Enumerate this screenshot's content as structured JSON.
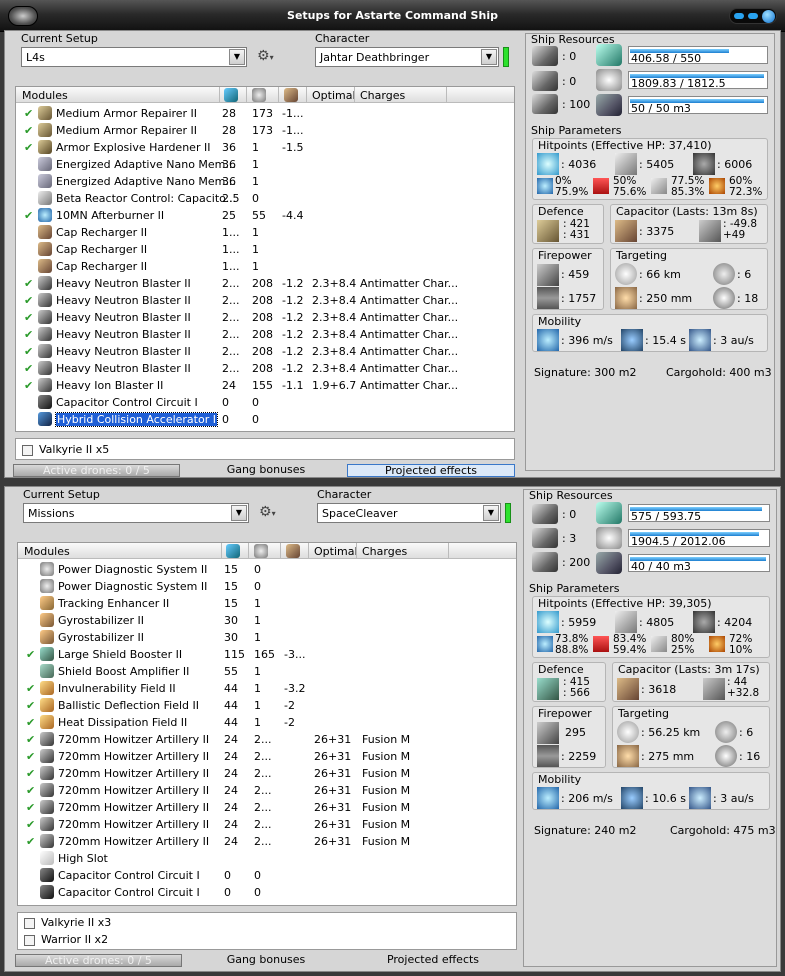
{
  "window": {
    "title": "Setups for Astarte Command Ship"
  },
  "colors": {
    "accent": "#1f5fd6",
    "ok": "#2de12d",
    "check": "#2a9a2a"
  },
  "labels": {
    "current_setup": "Current Setup",
    "character": "Character",
    "modules": "Modules",
    "optimal": "Optimal",
    "charges": "Charges",
    "ship_resources": "Ship Resources",
    "ship_parameters": "Ship Parameters",
    "defence": "Defence",
    "firepower": "Firepower",
    "targeting": "Targeting",
    "mobility": "Mobility",
    "gang_bonuses": "Gang bonuses",
    "projected_effects": "Projected effects",
    "active_drones": "Active drones: 0 / 5"
  },
  "setup1": {
    "setup_name": "L4s",
    "character": "Jahtar Deathbringer",
    "modules": [
      {
        "checked": true,
        "icon": "armor-repairer-icon",
        "name": "Medium Armor Repairer II",
        "cpu": "28",
        "pg": "173",
        "cap": "-1...",
        "optimal": "",
        "charges": ""
      },
      {
        "checked": true,
        "icon": "armor-repairer-icon",
        "name": "Medium Armor Repairer II",
        "cpu": "28",
        "pg": "173",
        "cap": "-1...",
        "optimal": "",
        "charges": ""
      },
      {
        "checked": true,
        "icon": "hardener-icon",
        "name": "Armor Explosive Hardener II",
        "cpu": "36",
        "pg": "1",
        "cap": "-1.5",
        "optimal": "",
        "charges": ""
      },
      {
        "checked": false,
        "icon": "nano-membrane-icon",
        "name": "Energized Adaptive Nano Mem...",
        "cpu": "36",
        "pg": "1",
        "cap": "",
        "optimal": "",
        "charges": ""
      },
      {
        "checked": false,
        "icon": "nano-membrane-icon",
        "name": "Energized Adaptive Nano Mem...",
        "cpu": "36",
        "pg": "1",
        "cap": "",
        "optimal": "",
        "charges": ""
      },
      {
        "checked": false,
        "icon": "capacitor-control-icon",
        "name": "Beta Reactor Control: Capacito...",
        "cpu": "2.5",
        "pg": "0",
        "cap": "",
        "optimal": "",
        "charges": ""
      },
      {
        "checked": true,
        "icon": "afterburner-icon",
        "name": "10MN Afterburner II",
        "cpu": "25",
        "pg": "55",
        "cap": "-4.4",
        "optimal": "",
        "charges": ""
      },
      {
        "checked": false,
        "icon": "cap-recharger-icon",
        "name": "Cap Recharger II",
        "cpu": "1...",
        "pg": "1",
        "cap": "",
        "optimal": "",
        "charges": ""
      },
      {
        "checked": false,
        "icon": "cap-recharger-icon",
        "name": "Cap Recharger II",
        "cpu": "1...",
        "pg": "1",
        "cap": "",
        "optimal": "",
        "charges": ""
      },
      {
        "checked": false,
        "icon": "cap-recharger-icon",
        "name": "Cap Recharger II",
        "cpu": "1...",
        "pg": "1",
        "cap": "",
        "optimal": "",
        "charges": ""
      },
      {
        "checked": true,
        "icon": "blaster-icon",
        "name": "Heavy Neutron Blaster II",
        "cpu": "2...",
        "pg": "208",
        "cap": "-1.2",
        "optimal": "2.3+8.4",
        "charges": "Antimatter Char..."
      },
      {
        "checked": true,
        "icon": "blaster-icon",
        "name": "Heavy Neutron Blaster II",
        "cpu": "2...",
        "pg": "208",
        "cap": "-1.2",
        "optimal": "2.3+8.4",
        "charges": "Antimatter Char..."
      },
      {
        "checked": true,
        "icon": "blaster-icon",
        "name": "Heavy Neutron Blaster II",
        "cpu": "2...",
        "pg": "208",
        "cap": "-1.2",
        "optimal": "2.3+8.4",
        "charges": "Antimatter Char..."
      },
      {
        "checked": true,
        "icon": "blaster-icon",
        "name": "Heavy Neutron Blaster II",
        "cpu": "2...",
        "pg": "208",
        "cap": "-1.2",
        "optimal": "2.3+8.4",
        "charges": "Antimatter Char..."
      },
      {
        "checked": true,
        "icon": "blaster-icon",
        "name": "Heavy Neutron Blaster II",
        "cpu": "2...",
        "pg": "208",
        "cap": "-1.2",
        "optimal": "2.3+8.4",
        "charges": "Antimatter Char..."
      },
      {
        "checked": true,
        "icon": "blaster-icon",
        "name": "Heavy Neutron Blaster II",
        "cpu": "2...",
        "pg": "208",
        "cap": "-1.2",
        "optimal": "2.3+8.4",
        "charges": "Antimatter Char..."
      },
      {
        "checked": true,
        "icon": "blaster-icon",
        "name": "Heavy Ion Blaster II",
        "cpu": "24",
        "pg": "155",
        "cap": "-1.1",
        "optimal": "1.9+6.7",
        "charges": "Antimatter Char..."
      },
      {
        "checked": false,
        "icon": "capacitor-circuit-icon",
        "name": "Capacitor Control Circuit I",
        "cpu": "0",
        "pg": "0",
        "cap": "",
        "optimal": "",
        "charges": ""
      },
      {
        "checked": false,
        "icon": "hybrid-accelerator-icon",
        "name": "Hybrid Collision Accelerator I",
        "cpu": "0",
        "pg": "0",
        "cap": "",
        "optimal": "",
        "charges": "",
        "selected": true
      }
    ],
    "drones": [
      "Valkyrie II x5"
    ],
    "resources": {
      "turret_slots": "0",
      "launcher_slots": "0",
      "calibration": "100",
      "cpu": "406.58 / 550",
      "cpu_fraction": 0.74,
      "powergrid": "1809.83 / 1812.5",
      "powergrid_fraction": 0.998,
      "drone_bay": "50 / 50 m3",
      "drone_bay_fraction": 1.0
    },
    "hitpoints_title": "Hitpoints (Effective HP: 37,410)",
    "hp": {
      "shield": "4036",
      "armor": "5405",
      "structure": "6006"
    },
    "resists": {
      "shield_em": "0%",
      "shield_thermal": "75.9%",
      "armor_em": "50%",
      "armor_thermal": "75.6%",
      "kinetic_a": "77.5%",
      "kinetic_b": "85.3%",
      "explosive_a": "60%",
      "explosive_b": "72.3%"
    },
    "defence": {
      "a": ": 421",
      "b": ": 431"
    },
    "capacitor_title": "Capacitor (Lasts: 13m 8s)",
    "capacitor": {
      "amount": ": 3375",
      "delta_a": ": -49.8",
      "delta_b": "+49"
    },
    "firepower": {
      "dps": ": 459",
      "volley": ": 1757"
    },
    "targeting": {
      "range": ": 66 km",
      "targets": ": 6",
      "resolution": ": 250 mm",
      "sensor": ": 18"
    },
    "mobility": {
      "speed": ": 396 m/s",
      "align": ": 15.4 s",
      "warp": ": 3 au/s"
    },
    "signature": "Signature: 300 m2",
    "cargohold": "Cargohold: 400 m3"
  },
  "setup2": {
    "setup_name": "Missions",
    "character": "SpaceCleaver",
    "modules": [
      {
        "checked": false,
        "icon": "power-diagnostic-icon",
        "name": "Power Diagnostic System II",
        "cpu": "15",
        "pg": "0",
        "cap": "",
        "optimal": "",
        "charges": ""
      },
      {
        "checked": false,
        "icon": "power-diagnostic-icon",
        "name": "Power Diagnostic System II",
        "cpu": "15",
        "pg": "0",
        "cap": "",
        "optimal": "",
        "charges": ""
      },
      {
        "checked": false,
        "icon": "tracking-enhancer-icon",
        "name": "Tracking Enhancer II",
        "cpu": "15",
        "pg": "1",
        "cap": "",
        "optimal": "",
        "charges": ""
      },
      {
        "checked": false,
        "icon": "gyrostabilizer-icon",
        "name": "Gyrostabilizer II",
        "cpu": "30",
        "pg": "1",
        "cap": "",
        "optimal": "",
        "charges": ""
      },
      {
        "checked": false,
        "icon": "gyrostabilizer-icon",
        "name": "Gyrostabilizer II",
        "cpu": "30",
        "pg": "1",
        "cap": "",
        "optimal": "",
        "charges": ""
      },
      {
        "checked": true,
        "icon": "shield-booster-icon",
        "name": "Large Shield Booster II",
        "cpu": "115",
        "pg": "165",
        "cap": "-3...",
        "optimal": "",
        "charges": ""
      },
      {
        "checked": false,
        "icon": "shield-amplifier-icon",
        "name": "Shield Boost Amplifier II",
        "cpu": "55",
        "pg": "1",
        "cap": "",
        "optimal": "",
        "charges": ""
      },
      {
        "checked": true,
        "icon": "invulnerability-field-icon",
        "name": "Invulnerability Field II",
        "cpu": "44",
        "pg": "1",
        "cap": "-3.2",
        "optimal": "",
        "charges": ""
      },
      {
        "checked": true,
        "icon": "deflection-field-icon",
        "name": "Ballistic Deflection Field II",
        "cpu": "44",
        "pg": "1",
        "cap": "-2",
        "optimal": "",
        "charges": ""
      },
      {
        "checked": true,
        "icon": "dissipation-field-icon",
        "name": "Heat Dissipation Field II",
        "cpu": "44",
        "pg": "1",
        "cap": "-2",
        "optimal": "",
        "charges": ""
      },
      {
        "checked": true,
        "icon": "artillery-icon",
        "name": "720mm Howitzer Artillery II",
        "cpu": "24",
        "pg": "2...",
        "cap": "",
        "optimal": "26+31",
        "charges": "Fusion M"
      },
      {
        "checked": true,
        "icon": "artillery-icon",
        "name": "720mm Howitzer Artillery II",
        "cpu": "24",
        "pg": "2...",
        "cap": "",
        "optimal": "26+31",
        "charges": "Fusion M"
      },
      {
        "checked": true,
        "icon": "artillery-icon",
        "name": "720mm Howitzer Artillery II",
        "cpu": "24",
        "pg": "2...",
        "cap": "",
        "optimal": "26+31",
        "charges": "Fusion M"
      },
      {
        "checked": true,
        "icon": "artillery-icon",
        "name": "720mm Howitzer Artillery II",
        "cpu": "24",
        "pg": "2...",
        "cap": "",
        "optimal": "26+31",
        "charges": "Fusion M"
      },
      {
        "checked": true,
        "icon": "artillery-icon",
        "name": "720mm Howitzer Artillery II",
        "cpu": "24",
        "pg": "2...",
        "cap": "",
        "optimal": "26+31",
        "charges": "Fusion M"
      },
      {
        "checked": true,
        "icon": "artillery-icon",
        "name": "720mm Howitzer Artillery II",
        "cpu": "24",
        "pg": "2...",
        "cap": "",
        "optimal": "26+31",
        "charges": "Fusion M"
      },
      {
        "checked": true,
        "icon": "artillery-icon",
        "name": "720mm Howitzer Artillery II",
        "cpu": "24",
        "pg": "2...",
        "cap": "",
        "optimal": "26+31",
        "charges": "Fusion M"
      },
      {
        "checked": false,
        "icon": "high-slot-icon",
        "name": "High Slot",
        "cpu": "",
        "pg": "",
        "cap": "",
        "optimal": "",
        "charges": ""
      },
      {
        "checked": false,
        "icon": "capacitor-circuit-icon",
        "name": "Capacitor Control Circuit I",
        "cpu": "0",
        "pg": "0",
        "cap": "",
        "optimal": "",
        "charges": ""
      },
      {
        "checked": false,
        "icon": "capacitor-circuit-icon",
        "name": "Capacitor Control Circuit I",
        "cpu": "0",
        "pg": "0",
        "cap": "",
        "optimal": "",
        "charges": ""
      }
    ],
    "drones": [
      "Valkyrie II x3",
      "Warrior II x2"
    ],
    "resources": {
      "turret_slots": "0",
      "launcher_slots": "3",
      "calibration": "200",
      "cpu": "575 / 593.75",
      "cpu_fraction": 0.97,
      "powergrid": "1904.5 / 2012.06",
      "powergrid_fraction": 0.95,
      "drone_bay": "40 / 40 m3",
      "drone_bay_fraction": 1.0
    },
    "hitpoints_title": "Hitpoints (Effective HP: 39,305)",
    "hp": {
      "shield": "5959",
      "armor": "4805",
      "structure": "4204"
    },
    "resists": {
      "shield_em": "73.8%",
      "shield_thermal": "88.8%",
      "armor_em": "83.4%",
      "armor_thermal": "59.4%",
      "kinetic_a": "80%",
      "kinetic_b": "25%",
      "explosive_a": "72%",
      "explosive_b": "10%"
    },
    "defence": {
      "a": ": 415",
      "b": ": 566"
    },
    "capacitor_title": "Capacitor (Lasts: 3m 17s)",
    "capacitor": {
      "amount": ": 3618",
      "delta_a": ": 44",
      "delta_b": "+32.8"
    },
    "firepower": {
      "dps": "295",
      "volley": ": 2259"
    },
    "targeting": {
      "range": ": 56.25 km",
      "targets": ": 6",
      "resolution": ": 275 mm",
      "sensor": ": 16"
    },
    "mobility": {
      "speed": ": 206 m/s",
      "align": ": 10.6 s",
      "warp": ": 3 au/s"
    },
    "signature": "Signature: 240 m2",
    "cargohold": "Cargohold: 475 m3"
  }
}
